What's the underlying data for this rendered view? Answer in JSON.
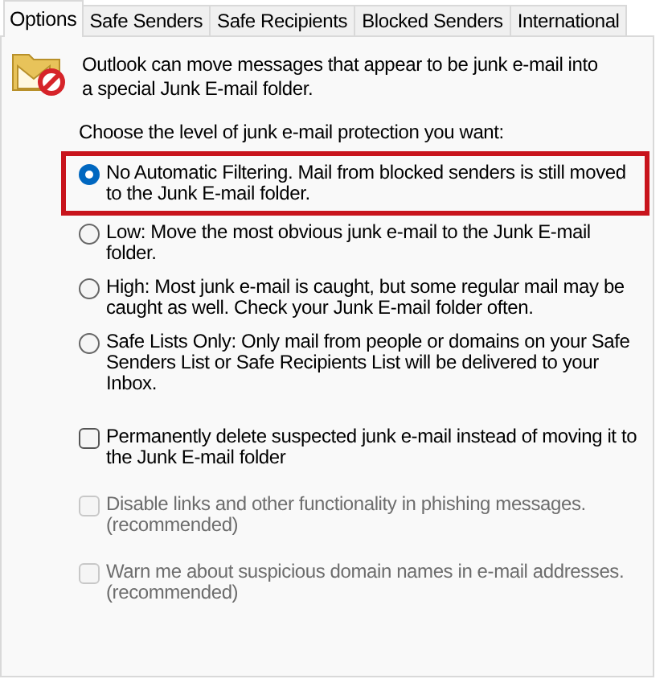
{
  "tabs": [
    {
      "label": "Options",
      "selected": true
    },
    {
      "label": "Safe Senders",
      "selected": false
    },
    {
      "label": "Safe Recipients",
      "selected": false
    },
    {
      "label": "Blocked Senders",
      "selected": false
    },
    {
      "label": "International",
      "selected": false
    }
  ],
  "intro": "Outlook can move messages that appear to be junk e-mail into a special Junk E-mail folder.",
  "prompt": "Choose the level of junk e-mail protection you want:",
  "levels": [
    {
      "label": "No Automatic Filtering. Mail from blocked senders is still moved to the Junk E-mail folder.",
      "selected": true,
      "highlighted": true
    },
    {
      "label": "Low: Move the most obvious junk e-mail to the Junk E-mail folder.",
      "selected": false,
      "highlighted": false
    },
    {
      "label": "High: Most junk e-mail is caught, but some regular mail may be caught as well. Check your Junk E-mail folder often.",
      "selected": false,
      "highlighted": false
    },
    {
      "label": "Safe Lists Only: Only mail from people or domains on your Safe Senders List or Safe Recipients List will be delivered to your Inbox.",
      "selected": false,
      "highlighted": false
    }
  ],
  "checkboxes": [
    {
      "label": "Permanently delete suspected junk e-mail instead of moving it to the Junk E-mail folder",
      "checked": false,
      "disabled": false
    },
    {
      "label": "Disable links and other functionality in phishing messages. (recommended)",
      "checked": false,
      "disabled": true
    },
    {
      "label": "Warn me about suspicious domain names in e-mail addresses. (recommended)",
      "checked": false,
      "disabled": true
    }
  ]
}
